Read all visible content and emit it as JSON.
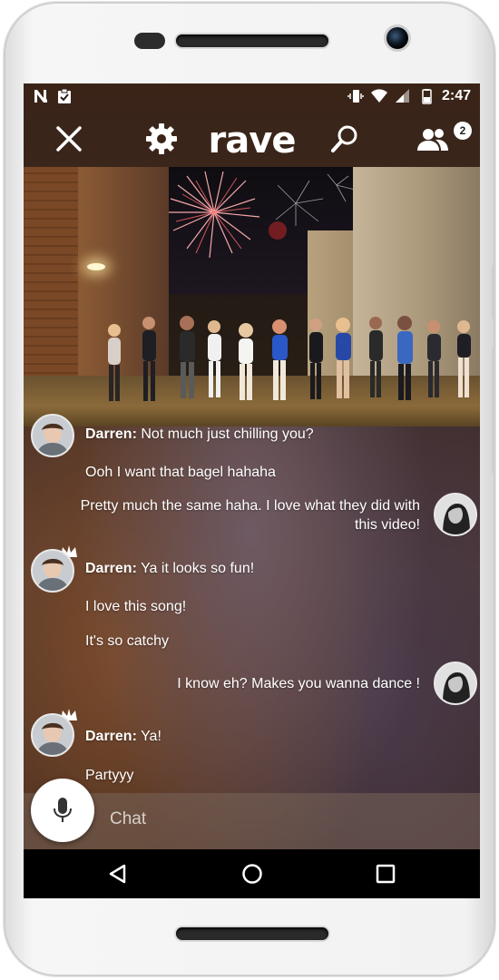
{
  "status_bar": {
    "time": "2:47",
    "left_icons": [
      "n-icon",
      "clipboard-check-icon"
    ],
    "right_icons": [
      "vibrate-icon",
      "wifi-icon",
      "signal-icon",
      "battery-icon"
    ]
  },
  "top_bar": {
    "logo": "rave",
    "participants_count": "2",
    "icons": [
      "close-icon",
      "gear-icon",
      "search-icon",
      "people-icon"
    ]
  },
  "messages": [
    {
      "sender": "Darren:",
      "text": "Not much just chilling you?"
    },
    {
      "text": "Ooh I want that bagel hahaha"
    },
    {
      "text_line1": "Pretty much the same haha. I love what they did with",
      "text_line2": "this video!"
    },
    {
      "sender": "Darren:",
      "text": "Ya it looks so fun!"
    },
    {
      "text": "I love this song!"
    },
    {
      "text": "It's so catchy"
    },
    {
      "text": "I know eh? Makes you wanna dance !"
    },
    {
      "sender": "Darren:",
      "text": "Ya!"
    },
    {
      "text": "Partyyy"
    }
  ],
  "input": {
    "placeholder": "Chat"
  },
  "colors": {
    "accent": "#ffffff",
    "badge_bg": "#ffffff",
    "nav_bg": "#000000"
  }
}
